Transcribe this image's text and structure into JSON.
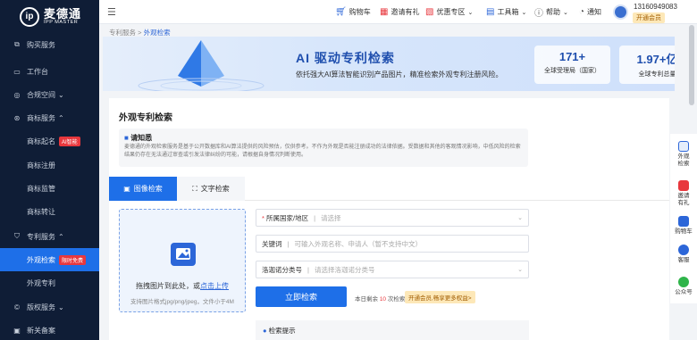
{
  "brand": {
    "logo_cn": "麦德通",
    "logo_en": "IPP MASTER"
  },
  "sidebar": {
    "items": [
      {
        "label": "购买服务",
        "icon": "cart-icon"
      },
      {
        "label": "工作台",
        "icon": "desktop-icon"
      },
      {
        "label": "合规空间",
        "icon": "shield-icon",
        "caret": "⌄"
      },
      {
        "label": "商标服务",
        "icon": "trademark-icon",
        "caret": "⌃"
      },
      {
        "label": "商标起名",
        "tag": "AI智能"
      },
      {
        "label": "商标注册"
      },
      {
        "label": "商标监管"
      },
      {
        "label": "商标转让"
      },
      {
        "label": "专利服务",
        "icon": "patent-icon",
        "caret": "⌃"
      },
      {
        "label": "外观检索",
        "tag": "限时免费"
      },
      {
        "label": "外观专利"
      },
      {
        "label": "版权服务",
        "icon": "copyright-icon",
        "caret": "⌄"
      },
      {
        "label": "新关备案",
        "icon": "record-icon"
      }
    ]
  },
  "topbar": {
    "menu_icon": "menu-icon",
    "cart": "购物车",
    "invite": "邀请有礼",
    "deals": "优惠专区",
    "toolbox": "工具箱",
    "help": "帮助",
    "notify": "通知",
    "phone": "13160949083",
    "vip": "开通会员"
  },
  "breadcrumb": {
    "parent": "专利服务",
    "sep": ">",
    "current": "外观检索"
  },
  "banner": {
    "title": "AI 驱动专利检索",
    "subtitle": "依托强大AI算法智能识别产品图片，精准检索外观专利注册风险。",
    "stats": [
      {
        "num": "171+",
        "label": "全球受理局（国家）"
      },
      {
        "num": "1.97+亿",
        "label": "全球专利总量"
      }
    ]
  },
  "card": {
    "title": "外观专利检索",
    "notice_head": "请知悉",
    "notice_body": "麦德通的外观检索服务是基于公开数据库和AI算法提供的风险预估，仅供参考。不作为外观是否能注册成功的法律依据。受数据和其他的客观情况影响，中低风险的检索结果仍存在无法通过审查或引发法律纠纷的可能，请根据自身情况判断使用。",
    "tabs": [
      "图像检索",
      "文字检索"
    ],
    "upload_main_prefix": "拖拽图片到此处，或",
    "upload_link": "点击上传",
    "upload_hint": "支持图片格式jpg/png/jpeg，文件小于4M",
    "fields": [
      {
        "label": "所属国家/地区",
        "required": true,
        "placeholder": "请选择",
        "select": true
      },
      {
        "label": "关键词",
        "required": false,
        "placeholder": "可输入外观名称、申请人（暂不支持中文）",
        "select": false
      },
      {
        "label": "洛迦诺分类号",
        "required": false,
        "placeholder": "请选择洛迦诺分类号",
        "select": true
      }
    ],
    "query_button": "立即检索",
    "quota_prefix": "本日剩余",
    "quota_num": "10",
    "quota_suffix": "次检索",
    "promo": "开通会员,畅享更多权益>",
    "tips": "检索提示"
  },
  "rightbar": [
    {
      "label": "外观检索",
      "icon": "search-icon"
    },
    {
      "label": "邀请有礼",
      "icon": "gift-icon"
    },
    {
      "label": "购物车",
      "icon": "cart-icon"
    },
    {
      "label": "客服",
      "icon": "support-icon"
    },
    {
      "label": "公众号",
      "icon": "wechat-icon"
    }
  ],
  "colors": {
    "primary": "#1e6fe8",
    "sidebar": "#0f1d36",
    "danger": "#e8373d",
    "vip": "#fde8b8"
  }
}
